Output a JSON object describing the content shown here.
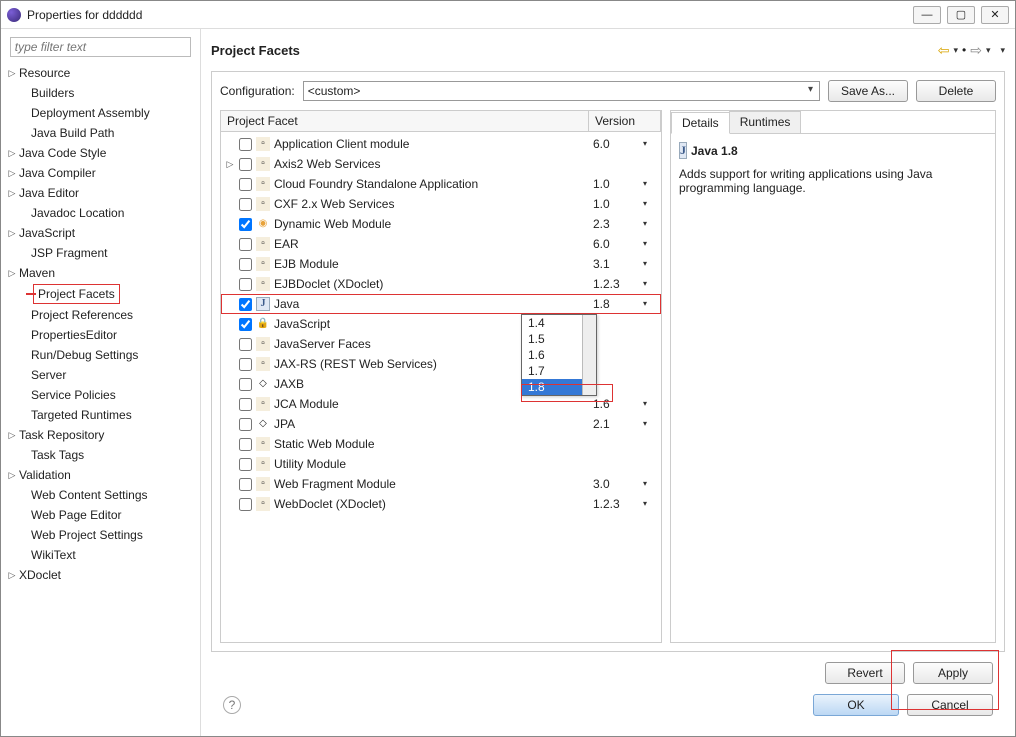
{
  "window": {
    "title": "Properties for dddddd"
  },
  "filter": {
    "placeholder": "type filter text"
  },
  "sidebar": [
    {
      "label": "Resource",
      "expand": "▷"
    },
    {
      "label": "Builders",
      "child": true
    },
    {
      "label": "Deployment Assembly",
      "child": true
    },
    {
      "label": "Java Build Path",
      "child": true
    },
    {
      "label": "Java Code Style",
      "expand": "▷"
    },
    {
      "label": "Java Compiler",
      "expand": "▷"
    },
    {
      "label": "Java Editor",
      "expand": "▷"
    },
    {
      "label": "Javadoc Location",
      "child": true
    },
    {
      "label": "JavaScript",
      "expand": "▷"
    },
    {
      "label": "JSP Fragment",
      "child": true
    },
    {
      "label": "Maven",
      "expand": "▷"
    },
    {
      "label": "Project Facets",
      "child": true,
      "selected": true
    },
    {
      "label": "Project References",
      "child": true
    },
    {
      "label": "PropertiesEditor",
      "child": true
    },
    {
      "label": "Run/Debug Settings",
      "child": true
    },
    {
      "label": "Server",
      "child": true
    },
    {
      "label": "Service Policies",
      "child": true
    },
    {
      "label": "Targeted Runtimes",
      "child": true
    },
    {
      "label": "Task Repository",
      "expand": "▷"
    },
    {
      "label": "Task Tags",
      "child": true
    },
    {
      "label": "Validation",
      "expand": "▷"
    },
    {
      "label": "Web Content Settings",
      "child": true
    },
    {
      "label": "Web Page Editor",
      "child": true
    },
    {
      "label": "Web Project Settings",
      "child": true
    },
    {
      "label": "WikiText",
      "child": true
    },
    {
      "label": "XDoclet",
      "expand": "▷"
    }
  ],
  "header": {
    "title": "Project Facets"
  },
  "config": {
    "label": "Configuration:",
    "value": "<custom>",
    "saveAs": "Save As...",
    "delete": "Delete"
  },
  "columns": {
    "name": "Project Facet",
    "version": "Version"
  },
  "facets": [
    {
      "name": "Application Client module",
      "version": "6.0",
      "icon": "f"
    },
    {
      "name": "Axis2 Web Services",
      "version": "",
      "icon": "f",
      "expand": "▷"
    },
    {
      "name": "Cloud Foundry Standalone Application",
      "version": "1.0",
      "icon": "f"
    },
    {
      "name": "CXF 2.x Web Services",
      "version": "1.0",
      "icon": "f"
    },
    {
      "name": "Dynamic Web Module",
      "version": "2.3",
      "icon": "g",
      "checked": true
    },
    {
      "name": "EAR",
      "version": "6.0",
      "icon": "f"
    },
    {
      "name": "EJB Module",
      "version": "3.1",
      "icon": "f"
    },
    {
      "name": "EJBDoclet (XDoclet)",
      "version": "1.2.3",
      "icon": "f"
    },
    {
      "name": "Java",
      "version": "1.8",
      "icon": "j",
      "checked": true,
      "selected": true
    },
    {
      "name": "JavaScript",
      "version": "",
      "icon": "lock",
      "checked": true
    },
    {
      "name": "JavaServer Faces",
      "version": "",
      "icon": "f"
    },
    {
      "name": "JAX-RS (REST Web Services)",
      "version": "",
      "icon": "f"
    },
    {
      "name": "JAXB",
      "version": "",
      "icon": "d"
    },
    {
      "name": "JCA Module",
      "version": "1.6",
      "icon": "f"
    },
    {
      "name": "JPA",
      "version": "2.1",
      "icon": "d"
    },
    {
      "name": "Static Web Module",
      "version": "",
      "icon": "f"
    },
    {
      "name": "Utility Module",
      "version": "",
      "icon": "f"
    },
    {
      "name": "Web Fragment Module",
      "version": "3.0",
      "icon": "f"
    },
    {
      "name": "WebDoclet (XDoclet)",
      "version": "1.2.3",
      "icon": "f"
    }
  ],
  "versionDropdown": {
    "options": [
      "1.4",
      "1.5",
      "1.6",
      "1.7",
      "1.8"
    ],
    "selected": "1.8"
  },
  "tabs": {
    "details": "Details",
    "runtimes": "Runtimes"
  },
  "details": {
    "title": "Java 1.8",
    "desc": "Adds support for writing applications using Java programming language."
  },
  "buttons": {
    "revert": "Revert",
    "apply": "Apply",
    "ok": "OK",
    "cancel": "Cancel"
  }
}
